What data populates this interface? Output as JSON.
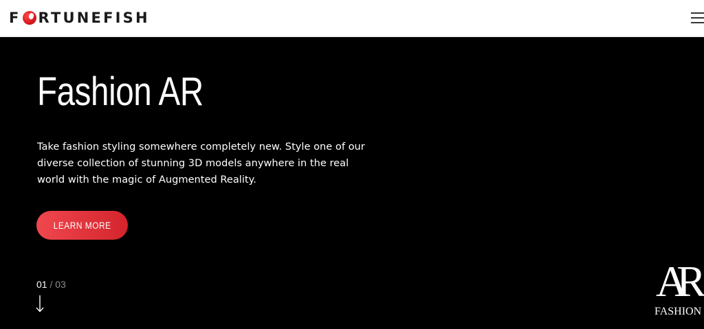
{
  "header": {
    "logo": {
      "first_letter": "F",
      "rest": "RTUNEFISH",
      "full_text": "FORTUNEFISH",
      "icon": "fish-ball-icon"
    },
    "menu_icon": "hamburger-menu-icon"
  },
  "hero": {
    "title": "Fashion AR",
    "description": "Take fashion styling somewhere completely new. Style one of our diverse collection of stunning 3D models anywhere in the real world with the magic of Augmented Reality.",
    "cta_label": "LEARN MORE",
    "cta_colors": [
      "#f0474e",
      "#d3242c"
    ]
  },
  "slider": {
    "current": "01",
    "separator": "/",
    "total": "03",
    "arrow_icon": "arrow-down-icon"
  },
  "badge": {
    "ar_text": "AR",
    "fashion_text": "FASHION"
  },
  "colors": {
    "background": "#000000",
    "header_bg": "#ffffff",
    "accent": "#e0323a"
  }
}
